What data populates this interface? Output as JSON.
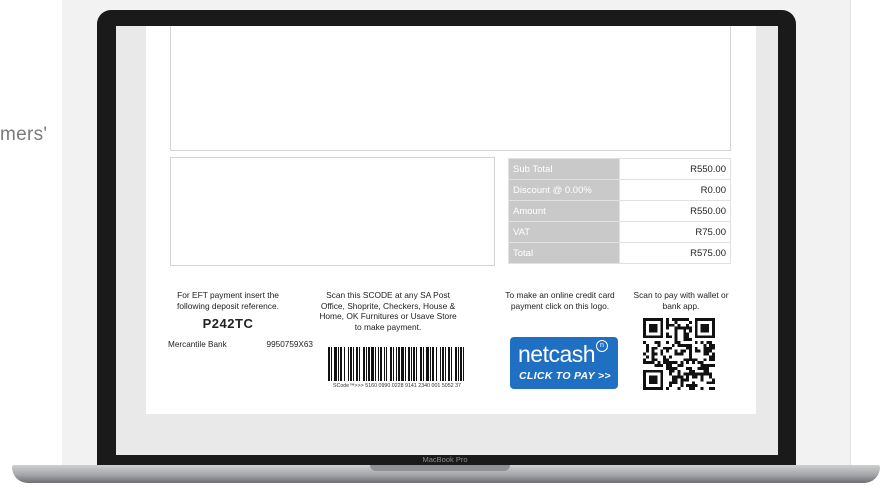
{
  "background": {
    "side_text": "mers'"
  },
  "device": {
    "label": "MacBook Pro"
  },
  "invoice": {
    "totals": [
      {
        "label": "Sub Total",
        "value": "R550.00"
      },
      {
        "label": "Discount @ 0.00%",
        "value": "R0.00"
      },
      {
        "label": "Amount",
        "value": "R550.00"
      },
      {
        "label": "VAT",
        "value": "R75.00"
      },
      {
        "label": "Total",
        "value": "R575.00"
      }
    ],
    "eft": {
      "instruction": "For EFT payment insert the following deposit reference.",
      "reference": "P242TC",
      "bank_name": "Mercantile Bank",
      "account_number": "9950759X63"
    },
    "scode": {
      "instruction": "Scan this SCODE at any SA Post Office, Shoprite, Checkers, House & Home, OK Furnitures or Usave Store to make payment.",
      "number": "SCode™>>> 5160 0990 0228 9141 2340 001 5052 37"
    },
    "netcash": {
      "instruction": "To make an online credit card payment click on this logo.",
      "logo_text": "netcash",
      "logo_mark": "n",
      "cta": "CLICK TO PAY >>"
    },
    "qr": {
      "instruction": "Scan to pay with wallet or bank app."
    }
  },
  "colors": {
    "label_cell": "#c9c9c9",
    "netcash_blue": "#1f6fc2",
    "laptop_bezel": "#1a1a1a"
  }
}
